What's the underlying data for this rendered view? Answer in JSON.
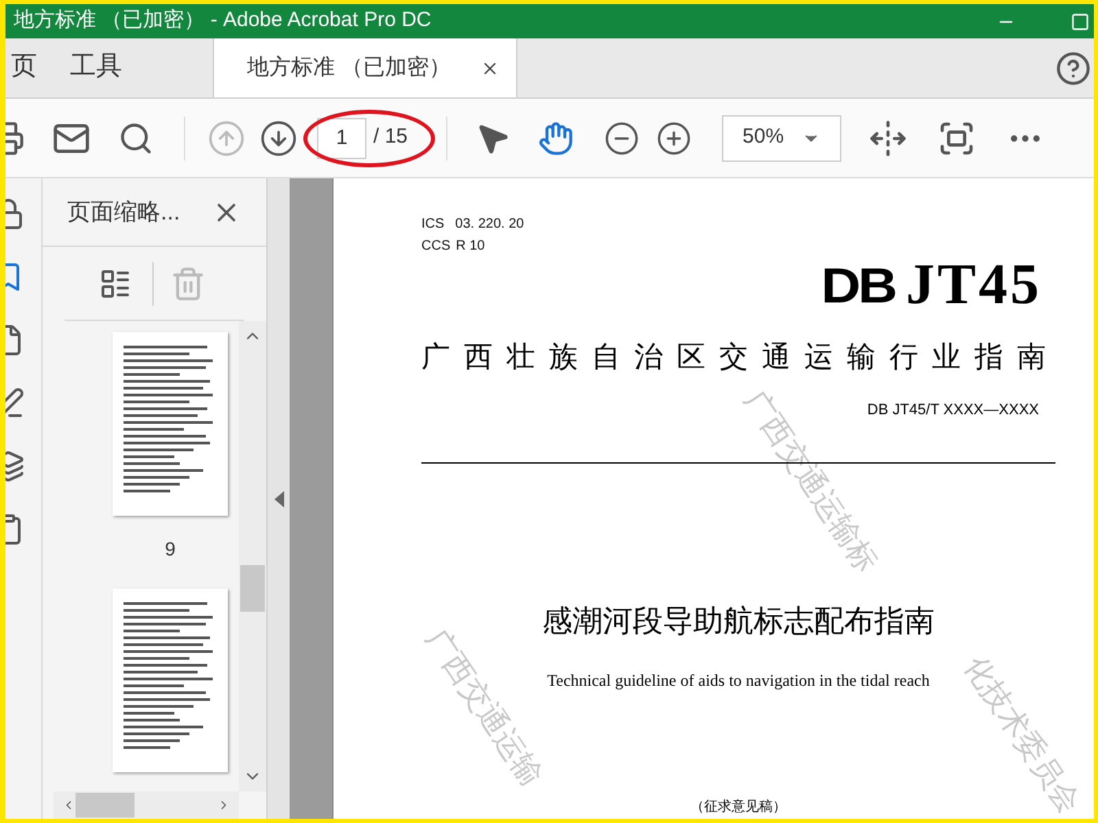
{
  "window": {
    "title": "地方标准 （已加密） - Adobe Acrobat Pro DC"
  },
  "tabs": [
    {
      "label": "页",
      "kind": "nav",
      "selected": false
    },
    {
      "label": "工具",
      "kind": "nav",
      "selected": false
    },
    {
      "label": "地方标准 （已加密）",
      "kind": "document",
      "selected": true
    }
  ],
  "toolbar": {
    "previous_disabled": true,
    "page_number": "1",
    "page_total": "/ 15",
    "zoom": "50%",
    "tools": [
      {
        "kind": "pointer",
        "selected": false
      },
      {
        "kind": "hand",
        "selected": true
      }
    ]
  },
  "side_rail": [
    {
      "kind": "lock",
      "selected": false
    },
    {
      "kind": "bookmark",
      "selected": true
    },
    {
      "kind": "file",
      "selected": false
    },
    {
      "kind": "pen",
      "selected": false
    },
    {
      "kind": "layers",
      "selected": false
    },
    {
      "kind": "clipboard",
      "selected": false
    }
  ],
  "thumbnails_panel": {
    "title": "页面缩略...",
    "delete_disabled": true,
    "pages": [
      {
        "kind": "labeled",
        "label": "9"
      },
      {
        "kind": "unlabeled"
      }
    ]
  },
  "document": {
    "ics_label": "ICS",
    "ics": "03. 220. 20",
    "ccs_label": "CCS",
    "ccs": "R 10",
    "logo_block": "DB",
    "logo_serif": "JT45",
    "issuer": "广西壮族自治区交通运输行业指南",
    "code": "DB JT45/T XXXX—XXXX",
    "title_zh": "感潮河段导助航标志配布指南",
    "title_en": "Technical guideline of aids to navigation in the tidal reach",
    "stage": "（征求意见稿）",
    "watermarks": [
      "广西交通运输",
      "广西交通运输标",
      "化技术委员会"
    ]
  }
}
